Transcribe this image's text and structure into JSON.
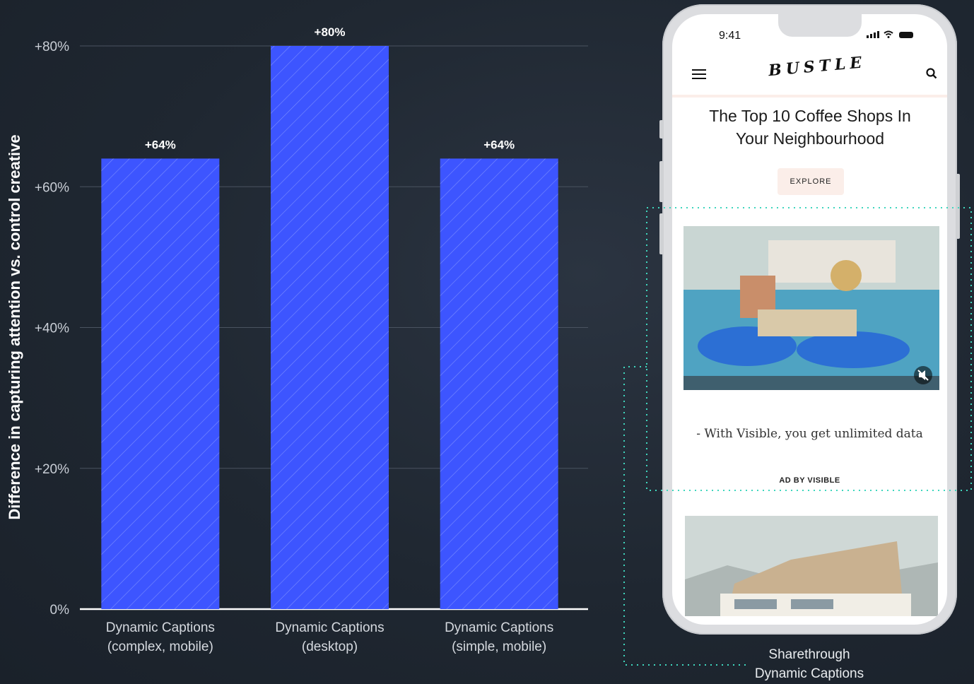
{
  "chart_data": {
    "type": "bar",
    "categories": [
      [
        "Dynamic Captions",
        "(complex, mobile)"
      ],
      [
        "Dynamic Captions",
        "(desktop)"
      ],
      [
        "Dynamic Captions",
        "(simple, mobile)"
      ]
    ],
    "values": [
      64,
      80,
      64
    ],
    "value_labels": [
      "+64%",
      "+80%",
      "+64%"
    ],
    "ylabel": "Difference in capturing attention vs. control creative",
    "yticks": [
      0,
      20,
      40,
      60,
      80
    ],
    "ytick_labels": [
      "0%",
      "+20%",
      "+40%",
      "+60%",
      "+80%"
    ],
    "ylim": [
      0,
      80
    ],
    "grid": true,
    "bar_color": "#3d55ff",
    "bar_pattern": "diagonal-hatch"
  },
  "phone": {
    "status_time": "9:41",
    "logo": "BUSTLE",
    "article_title": "The Top 10 Coffee Shops In Your Neighbourhood",
    "explore_label": "EXPLORE",
    "ad_quote": "- With Visible, you get unlimited data",
    "ad_by": "AD BY VISIBLE",
    "callout_color": "#3fd6bd"
  },
  "callout": {
    "line1": "Sharethrough",
    "line2": "Dynamic Captions"
  }
}
